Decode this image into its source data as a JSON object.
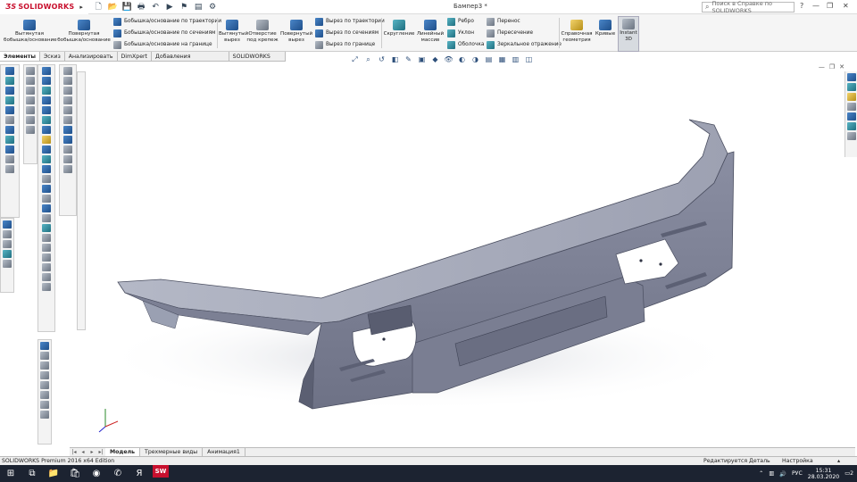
{
  "app": {
    "name": "SOLIDWORKS",
    "doc_title": "Бампер3 *"
  },
  "quick_access": [
    {
      "icon": "new-document-icon",
      "glyph": "🗋"
    },
    {
      "icon": "open-folder-icon",
      "glyph": "📂"
    },
    {
      "icon": "save-icon",
      "glyph": "💾"
    },
    {
      "icon": "print-icon",
      "glyph": "🖶"
    },
    {
      "icon": "undo-icon",
      "glyph": "↶"
    },
    {
      "icon": "select-icon",
      "glyph": "▶"
    },
    {
      "icon": "rebuild-icon",
      "glyph": "⚑"
    },
    {
      "icon": "file-properties-icon",
      "glyph": "▤"
    },
    {
      "icon": "options-gear-icon",
      "glyph": "⚙"
    }
  ],
  "search": {
    "placeholder": "Поиск в Справке по SOLIDWORKS"
  },
  "commands": {
    "extruded_boss": "Вытянутая\nбобышка/основание",
    "revolved_boss": "Повернутая\nбобышка/основание",
    "swept_boss": "Бобышка/основание по траектории",
    "lofted_boss": "Бобышка/основание по сечениям",
    "boundary_boss": "Бобышка/основание на границе",
    "extruded_cut": "Вытянутый\nвырез",
    "hole_wizard": "Отверстие\nпод крепеж",
    "revolved_cut": "Повернутый\nвырез",
    "swept_cut": "Вырез по траектории",
    "lofted_cut": "Вырез по сечениям",
    "boundary_cut": "Вырез по границе",
    "fillet": "Скругление",
    "linear_pattern": "Линейный\nмассив",
    "rib": "Ребро",
    "draft": "Уклон",
    "shell": "Оболочка",
    "wrap": "Перенос",
    "intersect": "Пересечение",
    "mirror": "Зеркальное отражение",
    "ref_geometry": "Справочная\nгеометрия",
    "curves": "Кривые",
    "instant3d": "Instant\n3D"
  },
  "tabs": [
    "Элементы",
    "Эскиз",
    "Анализировать",
    "DimXpert",
    "Добавления SOLIDWORKS",
    "SOLIDWORKS MBD"
  ],
  "bottom_tabs": [
    "Модель",
    "Трехмерные виды",
    "Анимация1"
  ],
  "status": {
    "left": "SOLIDWORKS Premium 2016 x64 Edition",
    "middle": "Редактируется Деталь",
    "right": "Настройка"
  },
  "taskbar": {
    "apps": [
      {
        "icon": "windows-start-icon",
        "glyph": "⊞"
      },
      {
        "icon": "task-view-icon",
        "glyph": "⧉"
      },
      {
        "icon": "file-explorer-icon",
        "glyph": "📁"
      },
      {
        "icon": "store-icon",
        "glyph": "🛍"
      },
      {
        "icon": "chrome-icon",
        "glyph": "◉"
      },
      {
        "icon": "viber-icon",
        "glyph": "✆"
      },
      {
        "icon": "yandex-icon",
        "glyph": "Я"
      },
      {
        "icon": "solidworks-taskbar-icon",
        "glyph": "SW"
      }
    ],
    "lang": "РУС",
    "time": "15:31",
    "date": "28.03.2020",
    "notifications": "2"
  },
  "colors": {
    "brand": "#c8102e",
    "model": "#8e92a4",
    "taskbar": "#1c2331"
  }
}
